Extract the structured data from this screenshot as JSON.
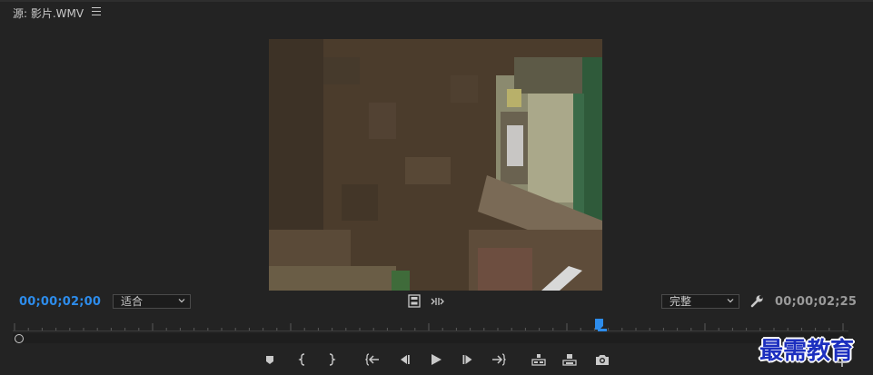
{
  "panel": {
    "tab_title": "源: 影片.WMV",
    "menu_icon": "hamburger-menu-icon"
  },
  "monitor": {
    "current_timecode": "00;00;02;00",
    "duration_timecode": "00;00;02;25",
    "zoom_value": "适合",
    "quality_value": "完整",
    "playhead_position_fraction": 0.71,
    "accent_color": "#2d8ceb"
  },
  "icons": {
    "zoom_dropdown": "chevron-down-icon",
    "quality_dropdown": "chevron-down-icon",
    "settings": "wrench-icon",
    "insert": "filmstrip-icon",
    "drag_audio_video": "drag-arrows-icon"
  },
  "transport": [
    {
      "name": "add-marker-button",
      "icon": "marker-icon"
    },
    {
      "name": "mark-in-button",
      "icon": "mark-in-icon"
    },
    {
      "name": "mark-out-button",
      "icon": "mark-out-icon"
    },
    {
      "name": "go-to-in-button",
      "icon": "go-to-in-icon"
    },
    {
      "name": "step-back-button",
      "icon": "step-back-icon"
    },
    {
      "name": "play-button",
      "icon": "play-icon"
    },
    {
      "name": "step-forward-button",
      "icon": "step-forward-icon"
    },
    {
      "name": "go-to-out-button",
      "icon": "go-to-out-icon"
    },
    {
      "name": "insert-button",
      "icon": "insert-icon"
    },
    {
      "name": "overwrite-button",
      "icon": "overwrite-icon"
    },
    {
      "name": "export-frame-button",
      "icon": "camera-icon"
    }
  ],
  "watermark": {
    "text": "最需教育"
  }
}
